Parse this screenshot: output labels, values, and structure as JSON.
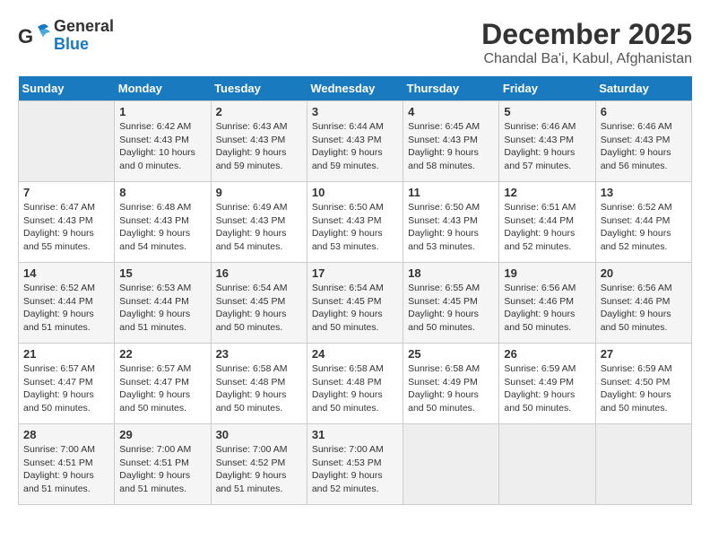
{
  "header": {
    "logo_general": "General",
    "logo_blue": "Blue",
    "month_year": "December 2025",
    "location": "Chandal Ba'i, Kabul, Afghanistan"
  },
  "days_of_week": [
    "Sunday",
    "Monday",
    "Tuesday",
    "Wednesday",
    "Thursday",
    "Friday",
    "Saturday"
  ],
  "weeks": [
    [
      {
        "day": "",
        "empty": true
      },
      {
        "day": "1",
        "sunrise": "Sunrise: 6:42 AM",
        "sunset": "Sunset: 4:43 PM",
        "daylight": "Daylight: 10 hours and 0 minutes."
      },
      {
        "day": "2",
        "sunrise": "Sunrise: 6:43 AM",
        "sunset": "Sunset: 4:43 PM",
        "daylight": "Daylight: 9 hours and 59 minutes."
      },
      {
        "day": "3",
        "sunrise": "Sunrise: 6:44 AM",
        "sunset": "Sunset: 4:43 PM",
        "daylight": "Daylight: 9 hours and 59 minutes."
      },
      {
        "day": "4",
        "sunrise": "Sunrise: 6:45 AM",
        "sunset": "Sunset: 4:43 PM",
        "daylight": "Daylight: 9 hours and 58 minutes."
      },
      {
        "day": "5",
        "sunrise": "Sunrise: 6:46 AM",
        "sunset": "Sunset: 4:43 PM",
        "daylight": "Daylight: 9 hours and 57 minutes."
      },
      {
        "day": "6",
        "sunrise": "Sunrise: 6:46 AM",
        "sunset": "Sunset: 4:43 PM",
        "daylight": "Daylight: 9 hours and 56 minutes."
      }
    ],
    [
      {
        "day": "7",
        "sunrise": "Sunrise: 6:47 AM",
        "sunset": "Sunset: 4:43 PM",
        "daylight": "Daylight: 9 hours and 55 minutes."
      },
      {
        "day": "8",
        "sunrise": "Sunrise: 6:48 AM",
        "sunset": "Sunset: 4:43 PM",
        "daylight": "Daylight: 9 hours and 54 minutes."
      },
      {
        "day": "9",
        "sunrise": "Sunrise: 6:49 AM",
        "sunset": "Sunset: 4:43 PM",
        "daylight": "Daylight: 9 hours and 54 minutes."
      },
      {
        "day": "10",
        "sunrise": "Sunrise: 6:50 AM",
        "sunset": "Sunset: 4:43 PM",
        "daylight": "Daylight: 9 hours and 53 minutes."
      },
      {
        "day": "11",
        "sunrise": "Sunrise: 6:50 AM",
        "sunset": "Sunset: 4:43 PM",
        "daylight": "Daylight: 9 hours and 53 minutes."
      },
      {
        "day": "12",
        "sunrise": "Sunrise: 6:51 AM",
        "sunset": "Sunset: 4:44 PM",
        "daylight": "Daylight: 9 hours and 52 minutes."
      },
      {
        "day": "13",
        "sunrise": "Sunrise: 6:52 AM",
        "sunset": "Sunset: 4:44 PM",
        "daylight": "Daylight: 9 hours and 52 minutes."
      }
    ],
    [
      {
        "day": "14",
        "sunrise": "Sunrise: 6:52 AM",
        "sunset": "Sunset: 4:44 PM",
        "daylight": "Daylight: 9 hours and 51 minutes."
      },
      {
        "day": "15",
        "sunrise": "Sunrise: 6:53 AM",
        "sunset": "Sunset: 4:44 PM",
        "daylight": "Daylight: 9 hours and 51 minutes."
      },
      {
        "day": "16",
        "sunrise": "Sunrise: 6:54 AM",
        "sunset": "Sunset: 4:45 PM",
        "daylight": "Daylight: 9 hours and 50 minutes."
      },
      {
        "day": "17",
        "sunrise": "Sunrise: 6:54 AM",
        "sunset": "Sunset: 4:45 PM",
        "daylight": "Daylight: 9 hours and 50 minutes."
      },
      {
        "day": "18",
        "sunrise": "Sunrise: 6:55 AM",
        "sunset": "Sunset: 4:45 PM",
        "daylight": "Daylight: 9 hours and 50 minutes."
      },
      {
        "day": "19",
        "sunrise": "Sunrise: 6:56 AM",
        "sunset": "Sunset: 4:46 PM",
        "daylight": "Daylight: 9 hours and 50 minutes."
      },
      {
        "day": "20",
        "sunrise": "Sunrise: 6:56 AM",
        "sunset": "Sunset: 4:46 PM",
        "daylight": "Daylight: 9 hours and 50 minutes."
      }
    ],
    [
      {
        "day": "21",
        "sunrise": "Sunrise: 6:57 AM",
        "sunset": "Sunset: 4:47 PM",
        "daylight": "Daylight: 9 hours and 50 minutes."
      },
      {
        "day": "22",
        "sunrise": "Sunrise: 6:57 AM",
        "sunset": "Sunset: 4:47 PM",
        "daylight": "Daylight: 9 hours and 50 minutes."
      },
      {
        "day": "23",
        "sunrise": "Sunrise: 6:58 AM",
        "sunset": "Sunset: 4:48 PM",
        "daylight": "Daylight: 9 hours and 50 minutes."
      },
      {
        "day": "24",
        "sunrise": "Sunrise: 6:58 AM",
        "sunset": "Sunset: 4:48 PM",
        "daylight": "Daylight: 9 hours and 50 minutes."
      },
      {
        "day": "25",
        "sunrise": "Sunrise: 6:58 AM",
        "sunset": "Sunset: 4:49 PM",
        "daylight": "Daylight: 9 hours and 50 minutes."
      },
      {
        "day": "26",
        "sunrise": "Sunrise: 6:59 AM",
        "sunset": "Sunset: 4:49 PM",
        "daylight": "Daylight: 9 hours and 50 minutes."
      },
      {
        "day": "27",
        "sunrise": "Sunrise: 6:59 AM",
        "sunset": "Sunset: 4:50 PM",
        "daylight": "Daylight: 9 hours and 50 minutes."
      }
    ],
    [
      {
        "day": "28",
        "sunrise": "Sunrise: 7:00 AM",
        "sunset": "Sunset: 4:51 PM",
        "daylight": "Daylight: 9 hours and 51 minutes."
      },
      {
        "day": "29",
        "sunrise": "Sunrise: 7:00 AM",
        "sunset": "Sunset: 4:51 PM",
        "daylight": "Daylight: 9 hours and 51 minutes."
      },
      {
        "day": "30",
        "sunrise": "Sunrise: 7:00 AM",
        "sunset": "Sunset: 4:52 PM",
        "daylight": "Daylight: 9 hours and 51 minutes."
      },
      {
        "day": "31",
        "sunrise": "Sunrise: 7:00 AM",
        "sunset": "Sunset: 4:53 PM",
        "daylight": "Daylight: 9 hours and 52 minutes."
      },
      {
        "day": "",
        "empty": true
      },
      {
        "day": "",
        "empty": true
      },
      {
        "day": "",
        "empty": true
      }
    ]
  ]
}
